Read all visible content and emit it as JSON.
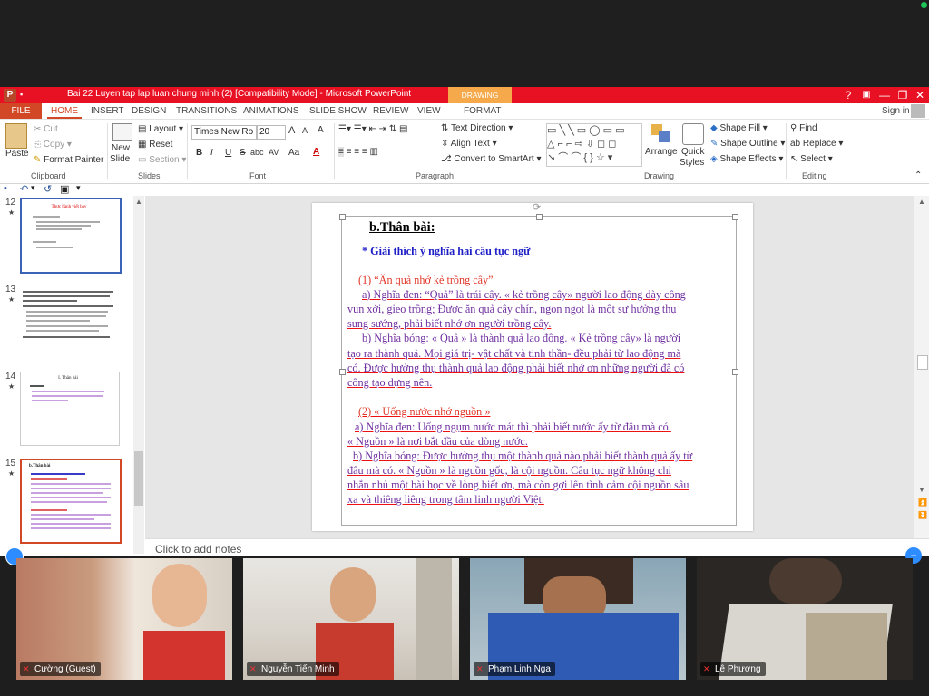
{
  "app": {
    "window_title": "Bai 22 Luyen tap lap luan chung minh (2) [Compatibility Mode] -  Microsoft PowerPoint",
    "contextual_tab_group": "DRAWING TOOLS",
    "sign_in": "Sign in",
    "window_buttons": [
      "?",
      "▣",
      "—",
      "❐",
      "✕"
    ]
  },
  "tabs": [
    "FILE",
    "HOME",
    "INSERT",
    "DESIGN",
    "TRANSITIONS",
    "ANIMATIONS",
    "SLIDE SHOW",
    "REVIEW",
    "VIEW",
    "FORMAT"
  ],
  "active_tab": "HOME",
  "ribbon": {
    "clipboard": {
      "paste": "Paste",
      "cut": "Cut",
      "copy": "Copy",
      "format_painter": "Format Painter",
      "group_label": "Clipboard"
    },
    "slides": {
      "new_slide": "New",
      "new_slide_2": "Slide",
      "layout": "Layout",
      "reset": "Reset",
      "section": "Section",
      "group_label": "Slides"
    },
    "font": {
      "font_name": "Times New Ro",
      "font_size": "20",
      "bold": "B",
      "italic": "I",
      "underline": "U",
      "strike": "S",
      "shadow": "abc",
      "spacing": "AV",
      "case": "Aa",
      "color": "A",
      "grow": "A",
      "shrink": "A",
      "clear": "A",
      "group_label": "Font"
    },
    "paragraph": {
      "text_direction": "Text Direction",
      "align_text": "Align Text",
      "convert_smartart": "Convert to SmartArt",
      "group_label": "Paragraph"
    },
    "drawing": {
      "arrange": "Arrange",
      "quick_styles": "Quick",
      "quick_styles_2": "Styles",
      "shape_fill": "Shape Fill",
      "shape_outline": "Shape Outline",
      "shape_effects": "Shape Effects",
      "group_label": "Drawing"
    },
    "editing": {
      "find": "Find",
      "replace": "Replace",
      "select": "Select",
      "group_label": "Editing"
    }
  },
  "thumbnails": [
    {
      "num": "12",
      "title": "Thực hành viết bày",
      "selected": false
    },
    {
      "num": "13",
      "title": "",
      "selected": false
    },
    {
      "num": "14",
      "title": "I. Thân bài",
      "selected": false
    },
    {
      "num": "15",
      "title": "b.Thân bài",
      "selected": true
    }
  ],
  "slide": {
    "heading": "b.Thân bài:",
    "subheading": "* Giải thích ý nghĩa hai câu tục ngữ",
    "p1_title": "(1) “Ăn quả nhớ kẻ trồng cây”",
    "p1_lines": [
      "a) Nghĩa đen: “Quả” là trái cây. «  kẻ trồng cây» người lao động dày công",
      "vun xới, gieo trồng; Được ăn quả cây chín, ngon ngọt là một sự hưởng thụ",
      "sung sướng, phải biết nhớ ơn người trồng cây.",
      "b) Nghĩa bóng: « Quả » là thành quả lao động. «  Kẻ trồng cây» là người",
      "tạo ra thành quả. Mọi giá trị- vật chất và tinh thần- đều phải từ lao động mà",
      "có. Được hưởng thụ thành quả lao động phải biết nhớ ơn những người đã có",
      "công tạo dựng nên."
    ],
    "p2_title": "(2) « Uống nước nhớ nguồn »",
    "p2_lines": [
      "a) Nghĩa đen: Uống ngụm nước mát thì phải biết nước ấy từ đâu mà có.",
      "« Nguồn » là nơi bắt đầu của dòng nước.",
      "b) Nghĩa bóng: Được hưởng thụ một thành quả nào phải biết thành quả ấy từ",
      "đâu mà có. « Nguồn » là nguồn gốc, là cội nguồn. Câu tục ngữ không chỉ",
      "nhắn nhủ một bài học về lòng biết ơn, mà còn gợi lên tình cảm cội nguồn sâu",
      "xa và thiêng liêng trong tâm linh người Việt."
    ]
  },
  "notes_placeholder": "Click to add notes",
  "participants": [
    {
      "name": "Cường (Guest)",
      "muted": true
    },
    {
      "name": "Nguyễn Tiến Minh",
      "muted": true
    },
    {
      "name": "Phạm Linh Nga",
      "muted": true
    },
    {
      "name": "Lê Phương",
      "muted": true
    }
  ]
}
